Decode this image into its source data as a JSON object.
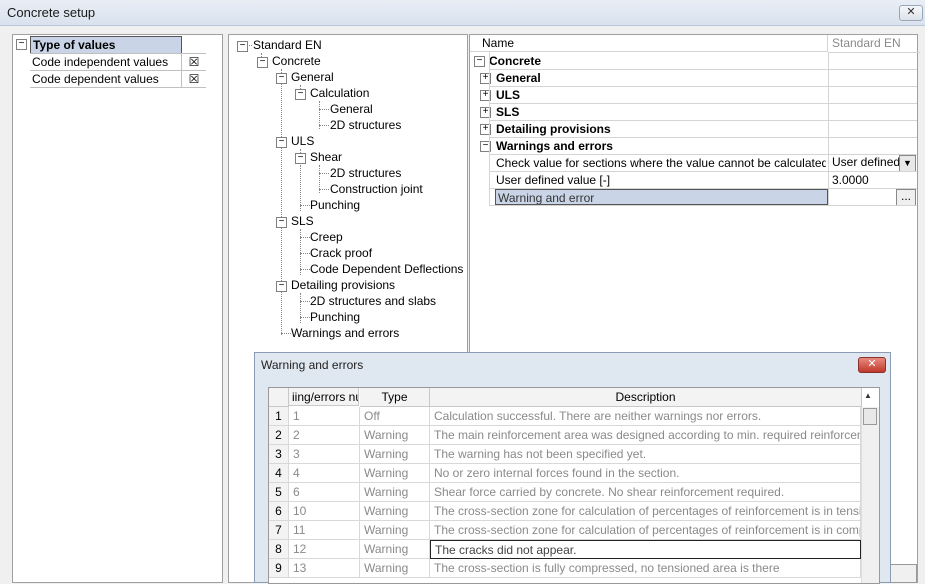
{
  "window": {
    "title": "Concrete setup",
    "close": "✕"
  },
  "left": {
    "header": "Type of values",
    "items": [
      {
        "label": "Code independent values",
        "checked": "☒"
      },
      {
        "label": "Code dependent values",
        "checked": "☒"
      }
    ]
  },
  "tree": {
    "nodes": [
      {
        "label": "Standard EN"
      },
      {
        "label": "Concrete"
      },
      {
        "label": "General"
      },
      {
        "label": "Calculation"
      },
      {
        "label": "General"
      },
      {
        "label": "2D structures"
      },
      {
        "label": "ULS"
      },
      {
        "label": "Shear"
      },
      {
        "label": "2D structures"
      },
      {
        "label": "Construction joint"
      },
      {
        "label": "Punching"
      },
      {
        "label": "SLS"
      },
      {
        "label": "Creep"
      },
      {
        "label": "Crack proof"
      },
      {
        "label": "Code Dependent Deflections"
      },
      {
        "label": "Detailing provisions"
      },
      {
        "label": "2D structures and slabs"
      },
      {
        "label": "Punching"
      },
      {
        "label": "Warnings and errors"
      }
    ]
  },
  "grid": {
    "col_name": "Name",
    "col_value": "Standard EN",
    "rows": [
      {
        "label": "Concrete",
        "value": ""
      },
      {
        "label": "General",
        "value": ""
      },
      {
        "label": "ULS",
        "value": ""
      },
      {
        "label": "SLS",
        "value": ""
      },
      {
        "label": "Detailing provisions",
        "value": ""
      },
      {
        "label": "Warnings and errors",
        "value": ""
      },
      {
        "label": "Check value for sections where the value cannot be calculated",
        "value": "User defined v"
      },
      {
        "label": "User defined value [-]",
        "value": "3.0000"
      },
      {
        "label": "Warning and error",
        "value": "..."
      }
    ]
  },
  "dialog": {
    "title": "Warning and errors",
    "close": "✕",
    "columns": [
      "",
      "iing/errors nu",
      "Type",
      "Description"
    ],
    "rows": [
      {
        "n": "1",
        "code": "1",
        "type": "Off",
        "desc": "Calculation successful. There are neither warnings nor errors."
      },
      {
        "n": "2",
        "code": "2",
        "type": "Warning",
        "desc": "The main reinforcement area was designed according to min. required reinforcement percer"
      },
      {
        "n": "3",
        "code": "3",
        "type": "Warning",
        "desc": "The warning has not been specified yet."
      },
      {
        "n": "4",
        "code": "4",
        "type": "Warning",
        "desc": "No or zero internal forces found in the section."
      },
      {
        "n": "5",
        "code": "6",
        "type": "Warning",
        "desc": "Shear force carried by concrete. No shear reinforcement required."
      },
      {
        "n": "6",
        "code": "10",
        "type": "Warning",
        "desc": "The cross-section zone for calculation of percentages of reinforcement is in tension."
      },
      {
        "n": "7",
        "code": "11",
        "type": "Warning",
        "desc": "The cross-section zone for calculation of percentages of reinforcement is in compression."
      },
      {
        "n": "8",
        "code": "12",
        "type": "Warning",
        "desc": "The cracks did not appear."
      },
      {
        "n": "9",
        "code": "13",
        "type": "Warning",
        "desc": "The cross-section is fully compressed, no tensioned area is there"
      }
    ]
  }
}
